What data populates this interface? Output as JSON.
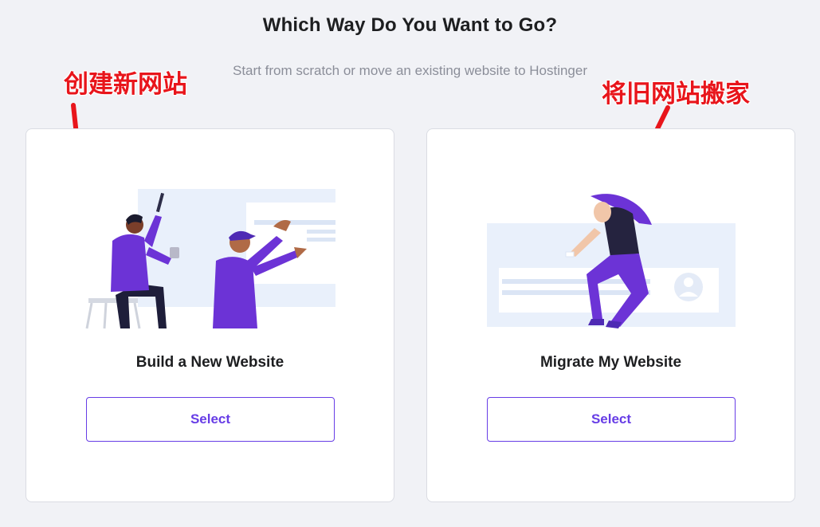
{
  "header": {
    "title": "Which Way Do You Want to Go?",
    "subtitle": "Start from scratch or move an existing website to Hostinger"
  },
  "annotations": {
    "left": "创建新网站",
    "right": "将旧网站搬家"
  },
  "options": [
    {
      "title": "Build a New Website",
      "button_label": "Select",
      "illustration": "builders-painting-illustration"
    },
    {
      "title": "Migrate My Website",
      "button_label": "Select",
      "illustration": "person-moving-website-illustration"
    }
  ],
  "colors": {
    "accent": "#673de6",
    "annotation": "#e8151b",
    "background": "#f1f2f6"
  }
}
